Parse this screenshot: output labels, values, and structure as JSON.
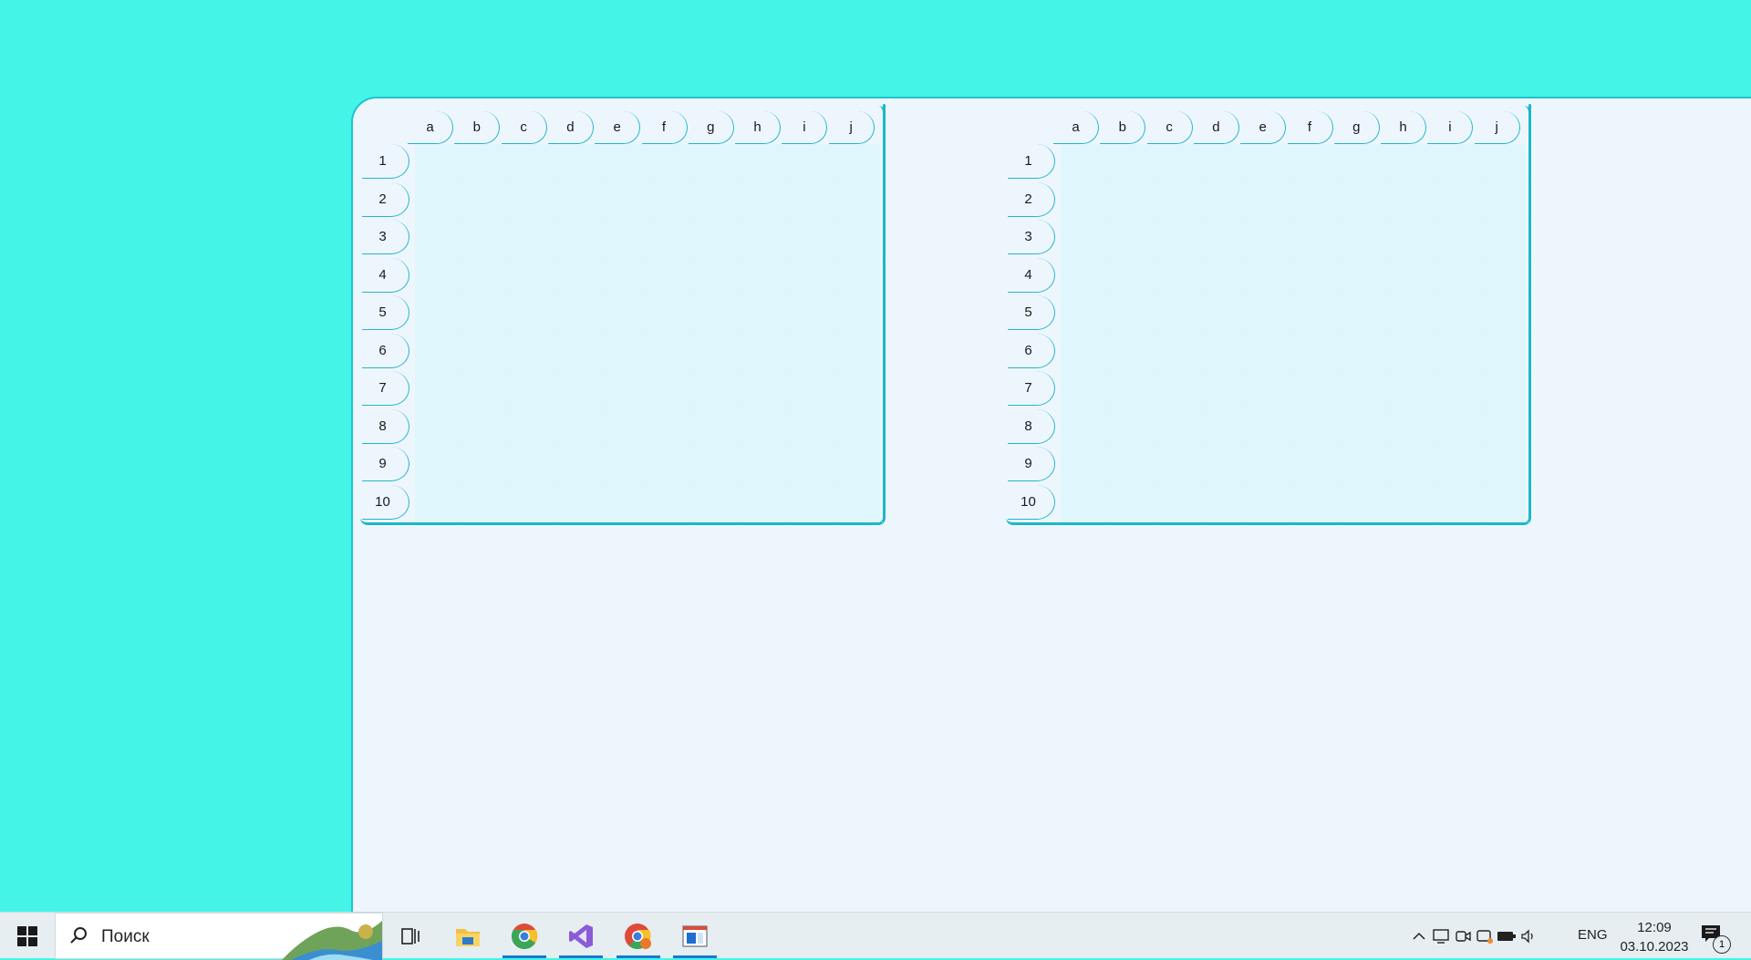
{
  "colors": {
    "desktop": "#44f4e6",
    "window_bg": "#eef6fd",
    "accent": "#1bb8c8",
    "grid_bg": "#e0f6fd"
  },
  "board_left": {
    "columns": [
      "a",
      "b",
      "c",
      "d",
      "e",
      "f",
      "g",
      "h",
      "i",
      "j"
    ],
    "rows": [
      "1",
      "2",
      "3",
      "4",
      "5",
      "6",
      "7",
      "8",
      "9",
      "10"
    ]
  },
  "board_right": {
    "columns": [
      "a",
      "b",
      "c",
      "d",
      "e",
      "f",
      "g",
      "h",
      "i",
      "j"
    ],
    "rows": [
      "1",
      "2",
      "3",
      "4",
      "5",
      "6",
      "7",
      "8",
      "9",
      "10"
    ]
  },
  "taskbar": {
    "search_placeholder": "Поиск",
    "pinned": [
      {
        "icon": "task-view-icon",
        "active": false
      },
      {
        "icon": "file-explorer-icon",
        "active": false
      },
      {
        "icon": "chrome-icon",
        "active": true
      },
      {
        "icon": "visual-studio-icon",
        "active": true
      },
      {
        "icon": "chrome-profile-icon",
        "active": true
      },
      {
        "icon": "app-window-icon",
        "active": true
      }
    ],
    "tray": {
      "icons": [
        "show-hidden-icons-chevron",
        "network-icon",
        "meet-icon",
        "onedrive-icon",
        "battery-icon",
        "volume-icon"
      ],
      "language": "ENG",
      "time": "12:09",
      "date": "03.10.2023",
      "notifications_count": "1"
    }
  }
}
